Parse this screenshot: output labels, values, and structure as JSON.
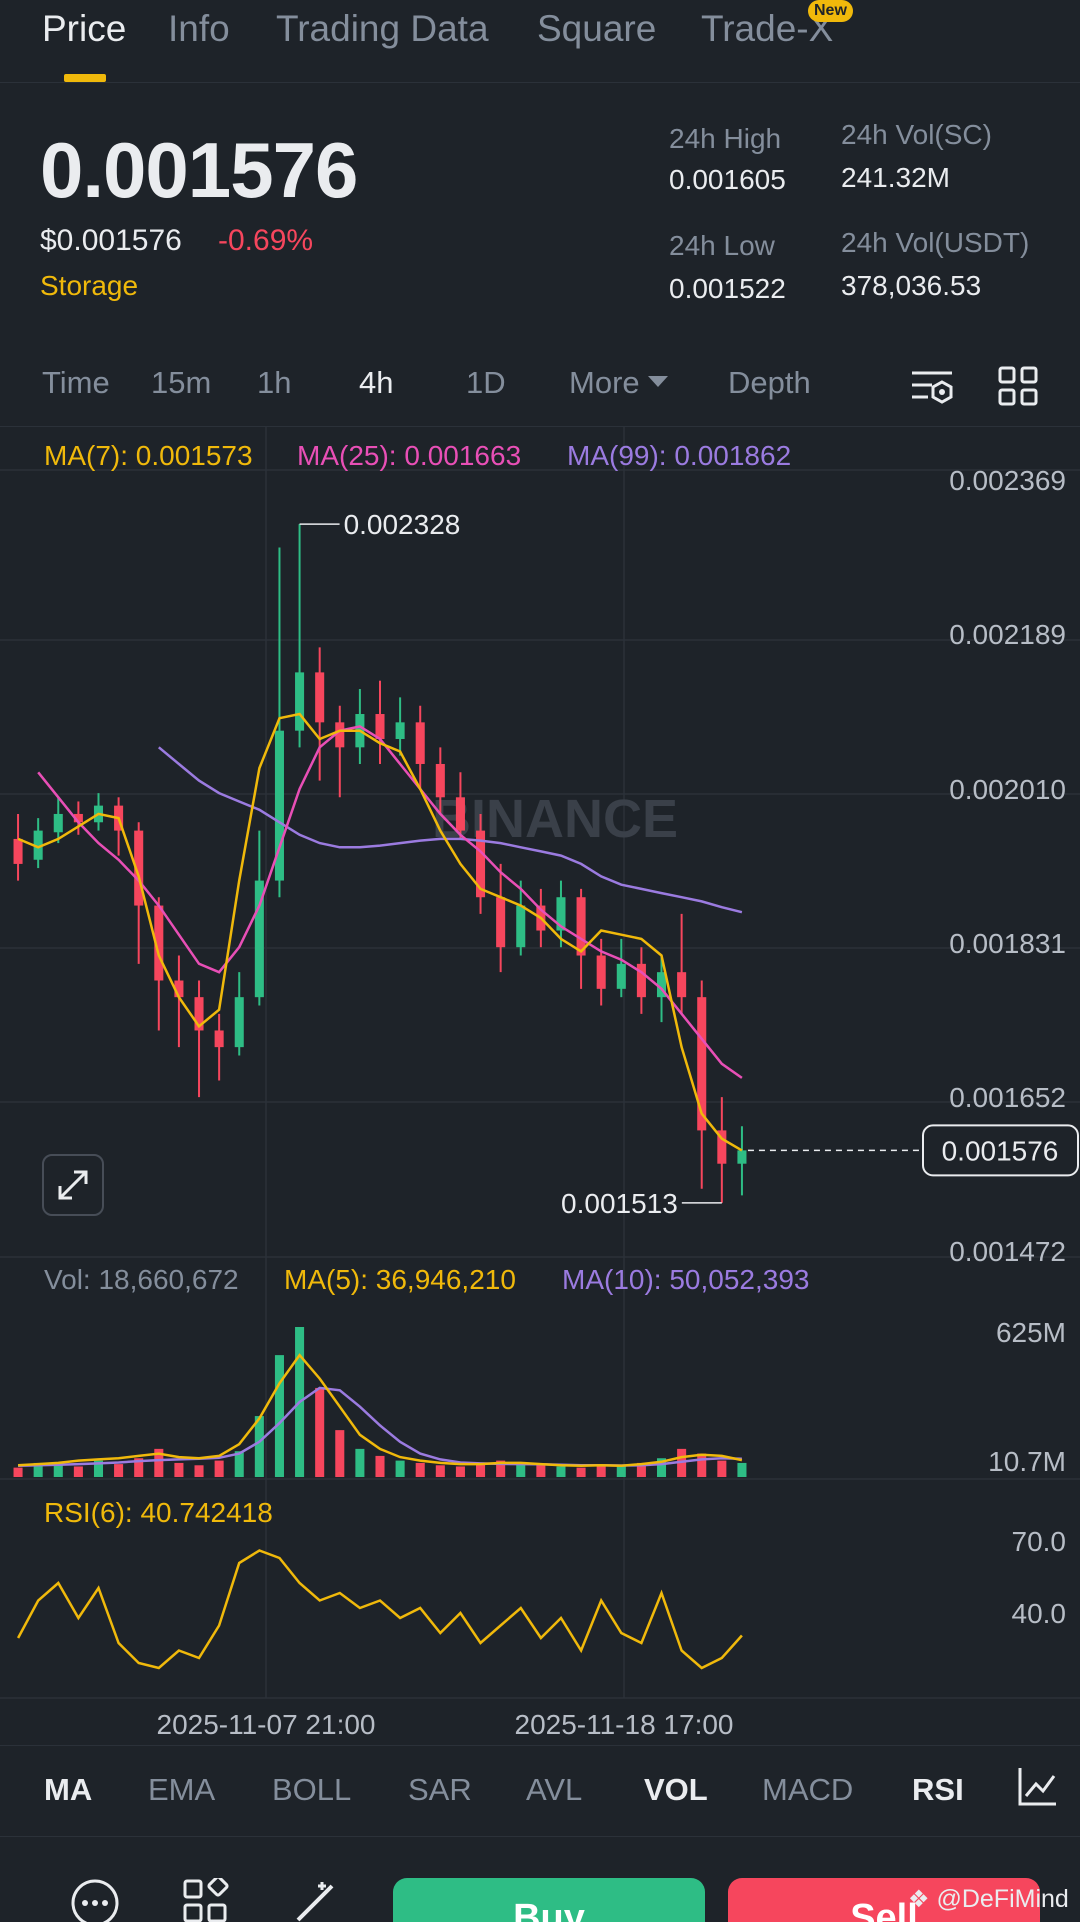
{
  "tabs": [
    {
      "label": "Price",
      "active": true
    },
    {
      "label": "Info",
      "active": false
    },
    {
      "label": "Trading Data",
      "active": false
    },
    {
      "label": "Square",
      "active": false
    },
    {
      "label": "Trade-X",
      "active": false
    }
  ],
  "new_badge": "New",
  "ticker": {
    "last_price": "0.001576",
    "usd_price": "$0.001576",
    "change": "-0.69%",
    "tag": "Storage"
  },
  "stats": {
    "high_label": "24h High",
    "high_value": "0.001605",
    "low_label": "24h Low",
    "low_value": "0.001522",
    "vol_sc_label": "24h Vol(SC)",
    "vol_sc_value": "241.32M",
    "vol_usdt_label": "24h Vol(USDT)",
    "vol_usdt_value": "378,036.53"
  },
  "intervals": {
    "time": "Time",
    "m15": "15m",
    "h1": "1h",
    "h4": "4h",
    "d1": "1D",
    "more": "More",
    "depth": "Depth",
    "selected": "4h"
  },
  "ma_legend": {
    "ma7": "MA(7): 0.001573",
    "ma25": "MA(25): 0.001663",
    "ma99": "MA(99): 0.001862"
  },
  "vol_legend": {
    "vol": "Vol: 18,660,672",
    "ma5": "MA(5): 36,946,210",
    "ma10": "MA(10): 50,052,393"
  },
  "rsi_legend": "RSI(6): 40.742418",
  "watermark_text": "BINANCE",
  "indicators": {
    "ma": "MA",
    "ema": "EMA",
    "boll": "BOLL",
    "sar": "SAR",
    "avl": "AVL",
    "vol": "VOL",
    "macd": "MACD",
    "rsi": "RSI"
  },
  "actions": {
    "buy": "Buy",
    "sell": "Sell"
  },
  "credit": "@DeFiMind",
  "colors": {
    "up": "#2ebd85",
    "down": "#f6465d",
    "ma7": "#f0b90b",
    "ma25": "#e84fb6",
    "ma99": "#9b7be0",
    "grid": "#2b3139",
    "axis_text": "#b7bdc6",
    "bg": "#1e2329"
  },
  "chart_data": {
    "type": "candlestick",
    "interval": "4h",
    "price_axis_ticks": [
      "0.002369",
      "0.002189",
      "0.002010",
      "0.001831",
      "0.001652",
      "0.001472"
    ],
    "price_range": [
      0.001472,
      0.002369
    ],
    "high_marker": "0.002328",
    "low_marker": "0.001513",
    "last_price_label": "0.001576",
    "x_ticks": [
      "2025-11-07 21:00",
      "2025-11-18 17:00"
    ],
    "volume_axis_ticks": [
      "625M",
      "10.7M"
    ],
    "rsi_axis_ticks": [
      "70.0",
      "40.0"
    ],
    "ma7": [
      0.00195,
      0.00194,
      0.00195,
      0.001965,
      0.00198,
      0.001975,
      0.001905,
      0.00181,
      0.00176,
      0.001725,
      0.001745,
      0.0019,
      0.002035,
      0.002095,
      0.0021,
      0.00207,
      0.00208,
      0.00208,
      0.002065,
      0.002055,
      0.00201,
      0.00196,
      0.00192,
      0.00189,
      0.00188,
      0.00187,
      0.001855,
      0.00183,
      0.001815,
      0.00184,
      0.001835,
      0.00183,
      0.00181,
      0.0017,
      0.00162,
      0.00159,
      0.001576
    ],
    "ma25": [
      0.00203,
      0.002,
      0.00197,
      0.001945,
      0.001925,
      0.0019,
      0.00187,
      0.001835,
      0.0018,
      0.00179,
      0.00182,
      0.00187,
      0.00194,
      0.00201,
      0.00206,
      0.00208,
      0.002085,
      0.00207,
      0.00204,
      0.00201,
      0.00198,
      0.001955,
      0.001935,
      0.00191,
      0.00189,
      0.001865,
      0.001845,
      0.00183,
      0.001815,
      0.001805,
      0.00179,
      0.00177,
      0.00174,
      0.00171,
      0.00168,
      0.001663
    ],
    "ma99": [
      0.00206,
      0.00204,
      0.00202,
      0.002005,
      0.001995,
      0.001985,
      0.00197,
      0.001955,
      0.001945,
      0.00194,
      0.00194,
      0.001942,
      0.001945,
      0.001948,
      0.00195,
      0.00195,
      0.001948,
      0.001945,
      0.00194,
      0.001935,
      0.00193,
      0.00192,
      0.001905,
      0.001895,
      0.00189,
      0.001885,
      0.00188,
      0.001875,
      0.001868,
      0.001862
    ],
    "candles": [
      {
        "o": 0.00195,
        "c": 0.00192,
        "h": 0.00198,
        "l": 0.0019
      },
      {
        "o": 0.001925,
        "c": 0.00196,
        "h": 0.001975,
        "l": 0.001915
      },
      {
        "o": 0.001958,
        "c": 0.00198,
        "h": 0.002,
        "l": 0.001945
      },
      {
        "o": 0.00198,
        "c": 0.00197,
        "h": 0.001995,
        "l": 0.001955
      },
      {
        "o": 0.00197,
        "c": 0.00199,
        "h": 0.002005,
        "l": 0.00196
      },
      {
        "o": 0.00199,
        "c": 0.00196,
        "h": 0.002,
        "l": 0.00193
      },
      {
        "o": 0.00196,
        "c": 0.00187,
        "h": 0.00197,
        "l": 0.0018
      },
      {
        "o": 0.00187,
        "c": 0.00178,
        "h": 0.00188,
        "l": 0.00172
      },
      {
        "o": 0.00178,
        "c": 0.00176,
        "h": 0.00181,
        "l": 0.0017
      },
      {
        "o": 0.00176,
        "c": 0.00172,
        "h": 0.00178,
        "l": 0.00164
      },
      {
        "o": 0.00172,
        "c": 0.0017,
        "h": 0.00174,
        "l": 0.00166
      },
      {
        "o": 0.0017,
        "c": 0.00176,
        "h": 0.00179,
        "l": 0.00169
      },
      {
        "o": 0.00176,
        "c": 0.0019,
        "h": 0.00196,
        "l": 0.00175
      },
      {
        "o": 0.0019,
        "c": 0.00208,
        "h": 0.0023,
        "l": 0.00188
      },
      {
        "o": 0.00208,
        "c": 0.00215,
        "h": 0.002328,
        "l": 0.00206
      },
      {
        "o": 0.00215,
        "c": 0.00209,
        "h": 0.00218,
        "l": 0.00202
      },
      {
        "o": 0.00209,
        "c": 0.00206,
        "h": 0.00211,
        "l": 0.002
      },
      {
        "o": 0.00206,
        "c": 0.0021,
        "h": 0.00213,
        "l": 0.00204
      },
      {
        "o": 0.0021,
        "c": 0.00207,
        "h": 0.00214,
        "l": 0.00204
      },
      {
        "o": 0.00207,
        "c": 0.00209,
        "h": 0.00212,
        "l": 0.00205
      },
      {
        "o": 0.00209,
        "c": 0.00204,
        "h": 0.00211,
        "l": 0.00201
      },
      {
        "o": 0.00204,
        "c": 0.002,
        "h": 0.00206,
        "l": 0.00198
      },
      {
        "o": 0.002,
        "c": 0.00196,
        "h": 0.00203,
        "l": 0.00195
      },
      {
        "o": 0.00196,
        "c": 0.00188,
        "h": 0.00198,
        "l": 0.00186
      },
      {
        "o": 0.00188,
        "c": 0.00182,
        "h": 0.00192,
        "l": 0.00179
      },
      {
        "o": 0.00182,
        "c": 0.00187,
        "h": 0.0019,
        "l": 0.00181
      },
      {
        "o": 0.00187,
        "c": 0.00184,
        "h": 0.00189,
        "l": 0.00182
      },
      {
        "o": 0.00184,
        "c": 0.00188,
        "h": 0.0019,
        "l": 0.00182
      },
      {
        "o": 0.00188,
        "c": 0.00181,
        "h": 0.00189,
        "l": 0.00177
      },
      {
        "o": 0.00181,
        "c": 0.00177,
        "h": 0.00183,
        "l": 0.00175
      },
      {
        "o": 0.00177,
        "c": 0.0018,
        "h": 0.00183,
        "l": 0.00176
      },
      {
        "o": 0.0018,
        "c": 0.00176,
        "h": 0.00182,
        "l": 0.00174
      },
      {
        "o": 0.00176,
        "c": 0.00179,
        "h": 0.00181,
        "l": 0.00173
      },
      {
        "o": 0.00179,
        "c": 0.00176,
        "h": 0.00186,
        "l": 0.00174
      },
      {
        "o": 0.00176,
        "c": 0.0016,
        "h": 0.00178,
        "l": 0.00153
      },
      {
        "o": 0.0016,
        "c": 0.00156,
        "h": 0.00164,
        "l": 0.001513
      },
      {
        "o": 0.00156,
        "c": 0.001576,
        "h": 0.001605,
        "l": 0.001522
      }
    ],
    "volume": [
      40,
      60,
      50,
      45,
      70,
      55,
      80,
      120,
      60,
      50,
      70,
      110,
      260,
      520,
      640,
      380,
      200,
      120,
      90,
      70,
      60,
      50,
      45,
      60,
      70,
      55,
      50,
      45,
      40,
      50,
      45,
      60,
      80,
      120,
      100,
      70,
      60
    ],
    "volume_ma5": [
      50,
      55,
      60,
      70,
      75,
      80,
      90,
      100,
      85,
      80,
      90,
      140,
      250,
      400,
      520,
      420,
      300,
      180,
      120,
      85,
      70,
      60,
      55,
      55,
      60,
      60,
      55,
      50,
      48,
      50,
      48,
      55,
      65,
      85,
      95,
      90,
      72
    ],
    "volume_ma10": [
      48,
      50,
      52,
      55,
      58,
      62,
      68,
      72,
      75,
      78,
      82,
      100,
      150,
      230,
      320,
      380,
      370,
      300,
      220,
      150,
      100,
      75,
      62,
      58,
      56,
      55,
      54,
      52,
      50,
      50,
      49,
      50,
      55,
      65,
      75,
      80,
      78
    ],
    "rsi6": [
      40,
      55,
      62,
      48,
      60,
      38,
      30,
      28,
      35,
      32,
      45,
      70,
      75,
      72,
      62,
      55,
      58,
      52,
      55,
      48,
      52,
      42,
      50,
      38,
      45,
      52,
      40,
      48,
      35,
      55,
      42,
      38,
      58,
      35,
      28,
      32,
      41
    ]
  }
}
